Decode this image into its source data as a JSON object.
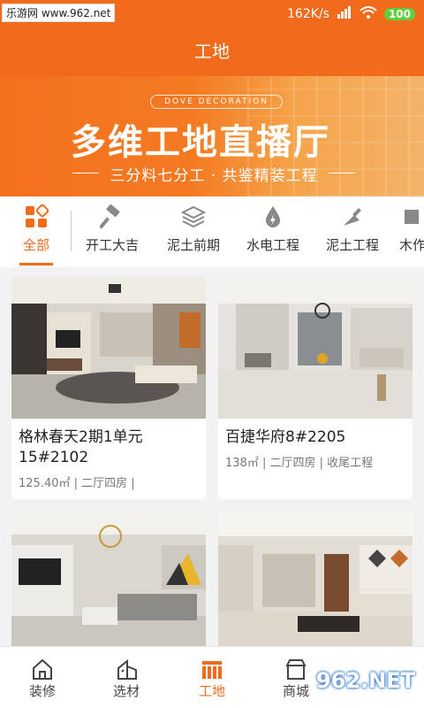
{
  "status_bar": {
    "watermark": "乐游网 www.962.net",
    "speed": "162K/s",
    "battery": "100"
  },
  "header": {
    "title": "工地"
  },
  "banner": {
    "en": "DOVE DECORATION",
    "title": "多维工地直播厅",
    "subtitle": "三分料七分工 · 共鉴精装工程"
  },
  "categories": [
    {
      "label": "全部",
      "icon": "grid-icon"
    },
    {
      "label": "开工大吉",
      "icon": "hammer-icon"
    },
    {
      "label": "泥土前期",
      "icon": "layers-icon"
    },
    {
      "label": "水电工程",
      "icon": "water-drop-icon"
    },
    {
      "label": "泥土工程",
      "icon": "trowel-icon"
    },
    {
      "label": "木作",
      "icon": "wood-icon"
    }
  ],
  "projects": [
    {
      "name": "格林春天2期1单元15#2102",
      "meta": "125.40㎡ | 二厅四房 |"
    },
    {
      "name": "百捷华府8#2205",
      "meta": "138㎡ | 二厅四房 | 收尾工程"
    },
    {
      "name": "",
      "meta": ""
    },
    {
      "name": "",
      "meta": ""
    }
  ],
  "bottom_nav": [
    {
      "label": "装修",
      "icon": "home-icon"
    },
    {
      "label": "选材",
      "icon": "material-icon"
    },
    {
      "label": "工地",
      "icon": "site-icon"
    },
    {
      "label": "商城",
      "icon": "store-icon"
    }
  ],
  "watermark_logo": "962.NET",
  "colors": {
    "accent": "#f26a1b"
  }
}
